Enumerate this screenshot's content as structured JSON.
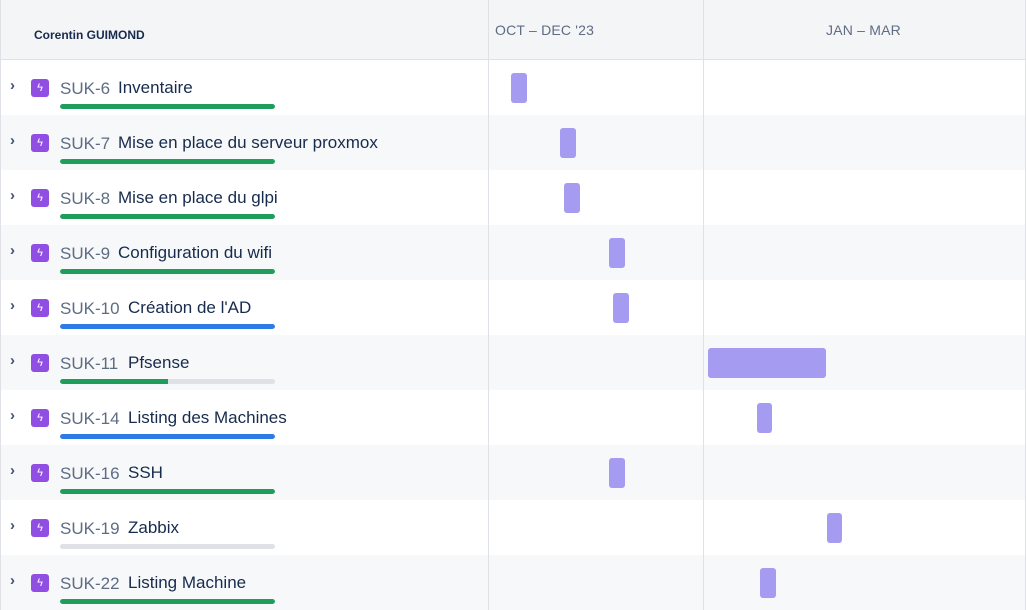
{
  "header": {
    "owner": "Corentin GUIMOND",
    "periods": [
      "OCT – DEC '23",
      "JAN – MAR"
    ]
  },
  "colors": {
    "done": "#1f9d5a",
    "in_progress": "#2d7be5",
    "todo": "#dfe1e6",
    "bar": "#a59bf0",
    "epic": "#904ee2"
  },
  "rows": [
    {
      "key": "SUK-6",
      "title": "Inventaire",
      "status": "done",
      "progress": 1.0
    },
    {
      "key": "SUK-7",
      "title": "Mise en place du serveur proxmox",
      "status": "done",
      "progress": 1.0
    },
    {
      "key": "SUK-8",
      "title": "Mise en place du glpi",
      "status": "done",
      "progress": 1.0
    },
    {
      "key": "SUK-9",
      "title": "Configuration du wifi",
      "status": "done",
      "progress": 1.0
    },
    {
      "key": "SUK-10",
      "title": "Création de l'AD",
      "status": "in_progress",
      "progress": 1.0
    },
    {
      "key": "SUK-11",
      "title": "Pfsense",
      "status": "done",
      "progress": 0.5
    },
    {
      "key": "SUK-14",
      "title": "Listing des Machines",
      "status": "in_progress",
      "progress": 1.0
    },
    {
      "key": "SUK-16",
      "title": "SSH",
      "status": "done",
      "progress": 1.0
    },
    {
      "key": "SUK-19",
      "title": "Zabbix",
      "status": "todo",
      "progress": 0.0
    },
    {
      "key": "SUK-22",
      "title": "Listing Machine",
      "status": "done",
      "progress": 1.0
    }
  ]
}
